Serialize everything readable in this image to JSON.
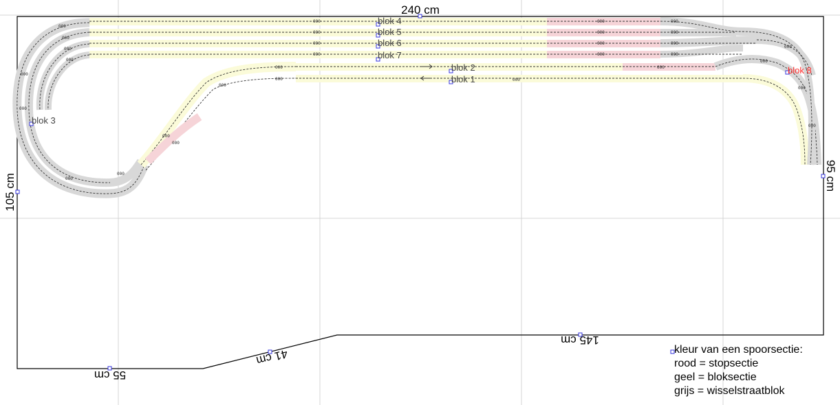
{
  "dimensions": {
    "top": "240 cm",
    "left": "105 cm",
    "right": "95 cm",
    "bottom_left": "55 cm",
    "bottom_diag": "41 cm",
    "bottom_right": "145 cm"
  },
  "blocks": {
    "b1": "blok 1",
    "b2": "blok 2",
    "b3": "blok 3",
    "b4": "blok 4",
    "b5": "blok 5",
    "b6": "blok 6",
    "b7": "blok 7",
    "b8": "blok 8"
  },
  "legend": {
    "title": "kleur van een spoorsectie:",
    "red": "rood = stopsectie",
    "yellow": "geel = bloksectie",
    "grey": "grijs = wisselstraatblok"
  },
  "colors": {
    "stop": "#f6d4d8",
    "block": "#fbfbd9",
    "switch": "#d8d8d8",
    "red_label": "#ff2b2b",
    "grid": "#d4d4d4",
    "handle": "#3333dd"
  }
}
